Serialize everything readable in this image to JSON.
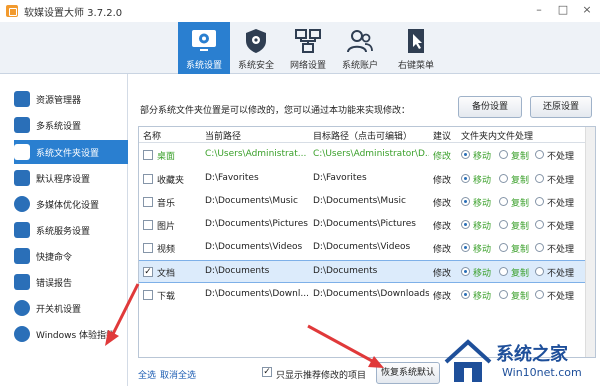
{
  "app": {
    "title": "软媒设置大师 3.7.2.0",
    "window_controls": [
      "–",
      "□",
      "×"
    ]
  },
  "toolbar": {
    "tabs": [
      {
        "label": "系统设置",
        "icon": "gear-screen-icon",
        "active": true
      },
      {
        "label": "系统安全",
        "icon": "shield-gear-icon",
        "active": false
      },
      {
        "label": "网络设置",
        "icon": "network-icon",
        "active": false
      },
      {
        "label": "系统账户",
        "icon": "users-icon",
        "active": false
      },
      {
        "label": "右键菜单",
        "icon": "cursor-menu-icon",
        "active": false
      }
    ]
  },
  "sidebar": {
    "items": [
      {
        "label": "资源管理器",
        "icon": "explorer-icon",
        "active": false
      },
      {
        "label": "多系统设置",
        "icon": "multi-system-icon",
        "active": false
      },
      {
        "label": "系统文件夹设置",
        "icon": "folder-settings-icon",
        "active": true
      },
      {
        "label": "默认程序设置",
        "icon": "default-program-icon",
        "active": false
      },
      {
        "label": "多媒体优化设置",
        "icon": "multimedia-icon",
        "active": false
      },
      {
        "label": "系统服务设置",
        "icon": "service-icon",
        "active": false
      },
      {
        "label": "快捷命令",
        "icon": "command-icon",
        "active": false
      },
      {
        "label": "错误报告",
        "icon": "error-report-icon",
        "active": false
      },
      {
        "label": "开关机设置",
        "icon": "power-icon",
        "active": false
      },
      {
        "label": "Windows 体验指数",
        "icon": "star-icon",
        "active": false
      }
    ]
  },
  "main": {
    "info": "部分系统文件夹位置是可以修改的，您可以通过本功能来实现修改：",
    "backup_label": "备份设置",
    "restore_label": "还原设置",
    "columns": [
      "名称",
      "当前路径",
      "目标路径（点击可编辑）",
      "建议",
      "文件夹内文件处理"
    ],
    "radio_options": [
      "移动",
      "复制",
      "不处理"
    ],
    "rows": [
      {
        "name": "桌面",
        "current": "C:\\Users\\Administrat...",
        "target": "C:\\Users\\Administrator\\D...",
        "advice": "修改",
        "checked": false,
        "green": true,
        "selected": false
      },
      {
        "name": "收藏夹",
        "current": "D:\\Favorites",
        "target": "D:\\Favorites",
        "advice": "修改",
        "checked": false,
        "green": false,
        "selected": false
      },
      {
        "name": "音乐",
        "current": "D:\\Documents\\Music",
        "target": "D:\\Documents\\Music",
        "advice": "修改",
        "checked": false,
        "green": false,
        "selected": false
      },
      {
        "name": "图片",
        "current": "D:\\Documents\\Pictures",
        "target": "D:\\Documents\\Pictures",
        "advice": "修改",
        "checked": false,
        "green": false,
        "selected": false
      },
      {
        "name": "视频",
        "current": "D:\\Documents\\Videos",
        "target": "D:\\Documents\\Videos",
        "advice": "修改",
        "checked": false,
        "green": false,
        "selected": false
      },
      {
        "name": "文档",
        "current": "D:\\Documents",
        "target": "D:\\Documents",
        "advice": "修改",
        "checked": true,
        "green": false,
        "selected": true
      },
      {
        "name": "下载",
        "current": "D:\\Documents\\Downl...",
        "target": "D:\\Documents\\Downloads",
        "advice": "修改",
        "checked": false,
        "green": false,
        "selected": false
      }
    ]
  },
  "footer": {
    "select_all": "全选",
    "deselect_all": "取消全选",
    "only_recommended": "只显示推荐修改的项目",
    "only_recommended_checked": true,
    "restore_default_label": "恢复系统默认"
  },
  "watermark": {
    "main": "系统之家",
    "sub": "Win10net.com"
  },
  "colors": {
    "accent": "#2a7fd0",
    "green_text": "#3aa02a",
    "arrow": "#e0393a"
  }
}
